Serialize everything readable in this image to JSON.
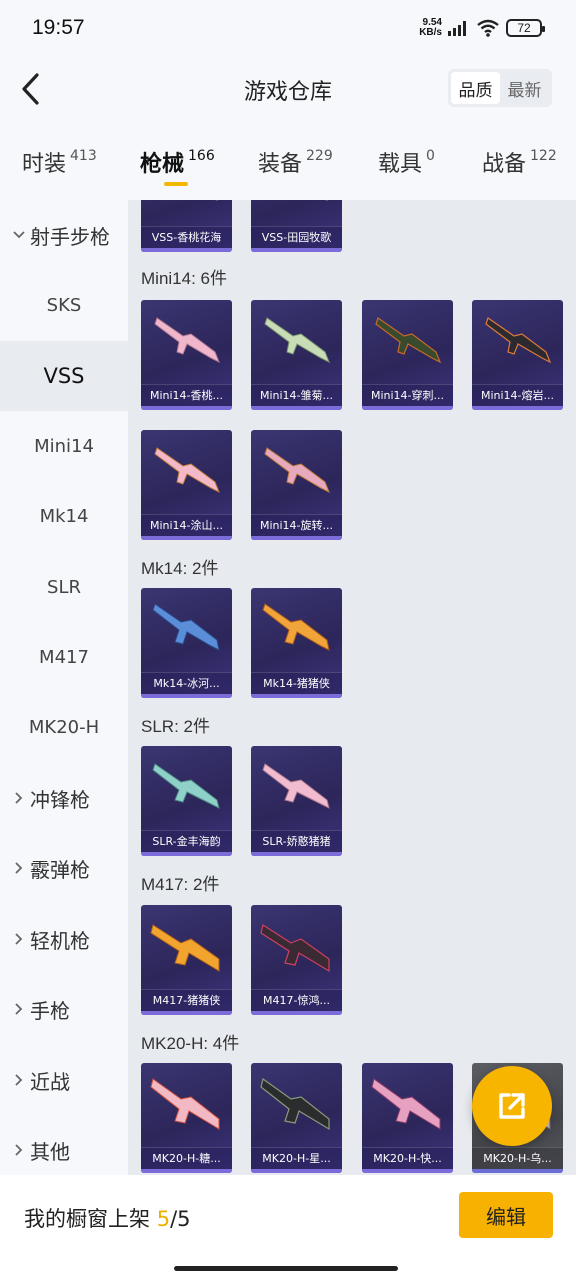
{
  "status": {
    "time": "19:57",
    "speed_value": "9.54",
    "speed_unit": "KB/s",
    "battery": "72"
  },
  "header": {
    "title": "游戏仓库",
    "sort_quality": "品质",
    "sort_newest": "最新"
  },
  "category_tabs": [
    {
      "label": "时装",
      "count": "413"
    },
    {
      "label": "枪械",
      "count": "166"
    },
    {
      "label": "装备",
      "count": "229"
    },
    {
      "label": "载具",
      "count": "0"
    },
    {
      "label": "战备",
      "count": "122"
    }
  ],
  "sidebar": {
    "group_sniper": "射手步枪",
    "items": [
      "SKS",
      "VSS",
      "Mini14",
      "Mk14",
      "SLR",
      "M417",
      "MK20-H"
    ],
    "groups": [
      "冲锋枪",
      "霰弹枪",
      "轻机枪",
      "手枪",
      "近战",
      "其他"
    ]
  },
  "sections": {
    "vss_cards": [
      "VSS-香桃花海",
      "VSS-田园牧歌"
    ],
    "mini14_title": "Mini14: 6件",
    "mini14_cards": [
      "Mini14-香桃...",
      "Mini14-雏菊...",
      "Mini14-穿刺...",
      "Mini14-熔岩...",
      "Mini14-涂山...",
      "Mini14-旋转..."
    ],
    "mk14_title": "Mk14: 2件",
    "mk14_cards": [
      "Mk14-冰河...",
      "Mk14-猪猪侠"
    ],
    "slr_title": "SLR: 2件",
    "slr_cards": [
      "SLR-金丰海韵",
      "SLR-娇憨猪猪"
    ],
    "m417_title": "M417: 2件",
    "m417_cards": [
      "M417-猪猪侠",
      "M417-惊鸿..."
    ],
    "mk20_title": "MK20-H: 4件",
    "mk20_cards": [
      "MK20-H-糖...",
      "MK20-H-星...",
      "MK20-H-快...",
      "MK20-H-乌..."
    ]
  },
  "bottom": {
    "showcase_label": "我的橱窗上架",
    "showcase_current": "5",
    "showcase_total": "/5",
    "edit_label": "编辑"
  },
  "colors": {
    "accent": "#f7b100",
    "card_bg": "#2f2a62",
    "card_line": "#7b6cd9"
  }
}
